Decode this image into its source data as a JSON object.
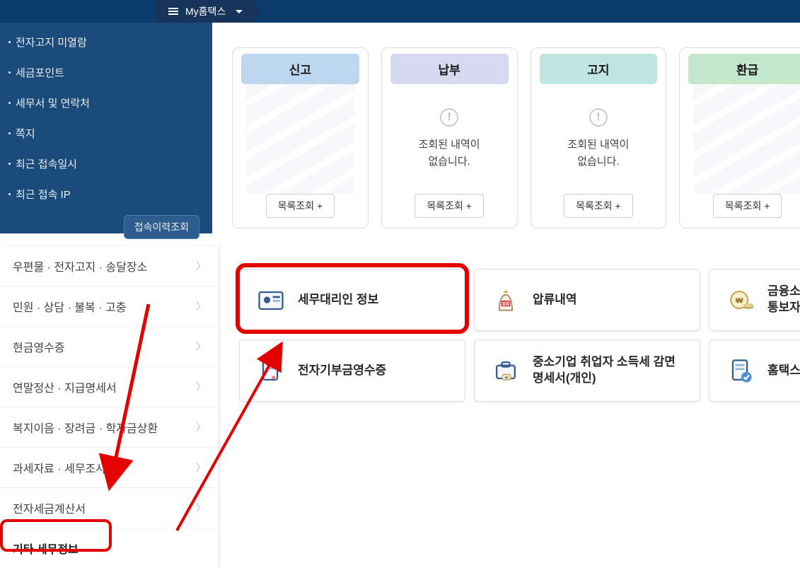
{
  "topbar": {
    "tab_label": "My홈택스"
  },
  "dark_sidebar": {
    "items": [
      "전자고지 미열람",
      "세금포인트",
      "세무서 및 연락처",
      "쪽지",
      "최근 접속일시",
      "최근 접속 IP"
    ],
    "history_button": "접속이력조회"
  },
  "light_sidebar": {
    "items": [
      "우편물 · 전자고지 · 송달장소",
      "민원 · 상담 · 불복 · 고충",
      "현금영수증",
      "연말정산 · 지급명세서",
      "복지이음 · 장려금 · 학자금상환",
      "과세자료 · 세무조사",
      "전자세금계산서",
      "기타 세무정보"
    ]
  },
  "cards": [
    {
      "title": "신고",
      "color": "blue",
      "empty": null,
      "list_button": "목록조회 +"
    },
    {
      "title": "납부",
      "color": "lilac",
      "empty": "조회된 내역이 없습니다.",
      "list_button": "목록조회 +"
    },
    {
      "title": "고지",
      "color": "teal",
      "empty": "조회된 내역이 없습니다.",
      "list_button": "목록조회 +"
    },
    {
      "title": "환급",
      "color": "mint",
      "empty": null,
      "list_button": "목록조회 +"
    }
  ],
  "tiles": [
    {
      "label": "세무대리인 정보",
      "icon": "id-card"
    },
    {
      "label": "압류내역",
      "icon": "seizure-bag"
    },
    {
      "label": "금융소득 통보자료",
      "icon": "won-coins",
      "partial": true
    },
    {
      "label": "전자기부금영수증",
      "icon": "donation-receipt"
    },
    {
      "label": "중소기업 취업자 소득세 감면 명세서(개인)",
      "icon": "briefcase-won"
    },
    {
      "label": "홈택스",
      "icon": "receipt-check",
      "partial": true
    }
  ]
}
